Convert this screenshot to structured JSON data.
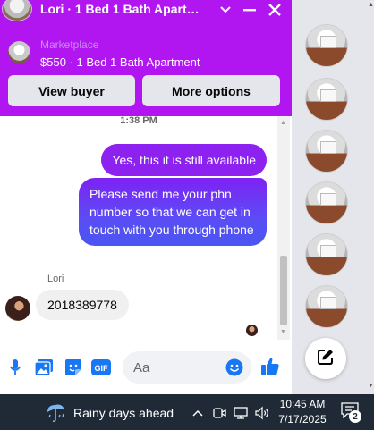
{
  "chat": {
    "title": "Lori · 1 Bed 1 Bath Apartm…",
    "marketplace_label": "Marketplace",
    "listing_title": "$550 · 1 Bed 1 Bath Apartment",
    "view_buyer_label": "View buyer",
    "more_options_label": "More options",
    "timestamp": "1:38 PM",
    "messages": [
      {
        "direction": "out",
        "text": "Yes, this it is still available"
      },
      {
        "direction": "out",
        "text": "Please send me your phn number so that we can get in touch with you through phone"
      },
      {
        "direction": "in",
        "sender": "Lori",
        "text": "2018389778"
      }
    ],
    "composer_placeholder": "Aa"
  },
  "taskbar": {
    "weather_text": "Rainy days ahead",
    "time": "10:45 AM",
    "date": "7/17/2025",
    "notification_count": "2"
  },
  "colors": {
    "header_bg": "#b116f0",
    "bubble_out": "#8d22f0",
    "accent_blue": "#1877f2",
    "taskbar_bg": "#202a36"
  },
  "icons": [
    "chevron-down-icon",
    "minimize-icon",
    "close-icon",
    "microphone-icon",
    "image-icon",
    "sticker-icon",
    "gif-icon",
    "emoji-icon",
    "thumbs-up-icon",
    "compose-icon",
    "rain-cloud-icon",
    "chevron-up-icon",
    "meet-now-icon",
    "network-icon",
    "volume-icon",
    "notification-icon"
  ]
}
